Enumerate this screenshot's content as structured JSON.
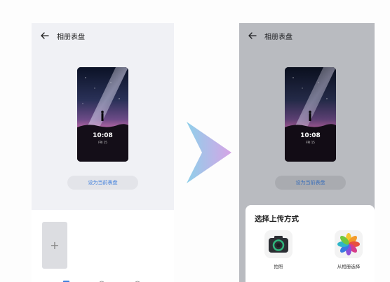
{
  "left_screen": {
    "title": "相册表盘",
    "watch_time": "10:08",
    "watch_date": "FRI 15",
    "set_button": "设为当前表盘",
    "add_tile": "+"
  },
  "right_screen": {
    "title": "相册表盘",
    "watch_time": "10:08",
    "watch_date": "FRI 15",
    "set_button": "设为当前表盘",
    "sheet": {
      "title": "选择上传方式",
      "options": [
        {
          "label": "拍照",
          "icon": "camera-icon"
        },
        {
          "label": "从相册选择",
          "icon": "photos-pinwheel-icon"
        }
      ]
    }
  },
  "colors": {
    "accent_blue": "#3f7fdc",
    "panel_light": "#f0f1f5",
    "panel_dimmed": "#b9bbc0",
    "camera_green": "#2fb67c",
    "transition_arrow_start": "#8fd0ea",
    "transition_arrow_end": "#d6a4e6"
  }
}
